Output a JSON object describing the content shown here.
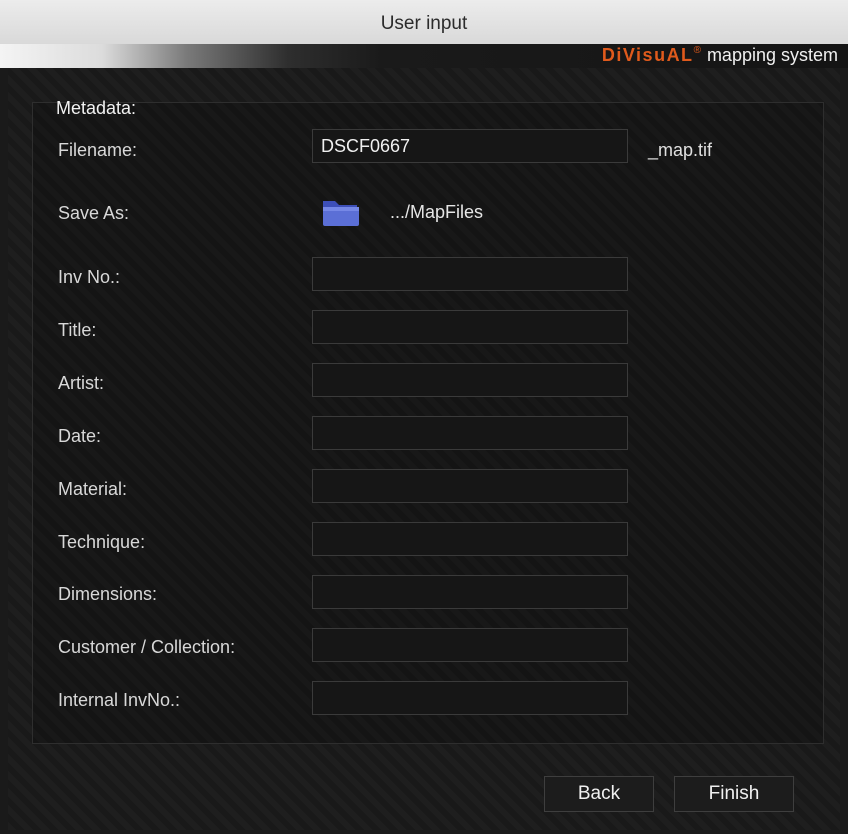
{
  "window": {
    "title": "User input"
  },
  "banner": {
    "brand_name": "DiVisuAL",
    "brand_reg": "®",
    "brand_sub": "mapping system"
  },
  "form": {
    "heading": "Metadata:",
    "filename": {
      "label": "Filename:",
      "value": "DSCF0667",
      "suffix": "_map.tif"
    },
    "save_as": {
      "label": "Save As:",
      "path": ".../MapFiles"
    },
    "fields": [
      {
        "label": "Inv No.:",
        "value": ""
      },
      {
        "label": "Title:",
        "value": ""
      },
      {
        "label": "Artist:",
        "value": ""
      },
      {
        "label": "Date:",
        "value": ""
      },
      {
        "label": "Material:",
        "value": ""
      },
      {
        "label": "Technique:",
        "value": ""
      },
      {
        "label": "Dimensions:",
        "value": ""
      },
      {
        "label": "Customer / Collection:",
        "value": ""
      },
      {
        "label": "Internal InvNo.:",
        "value": ""
      }
    ]
  },
  "buttons": {
    "back": "Back",
    "finish": "Finish"
  },
  "icons": {
    "save_folder": "folder-icon"
  },
  "colors": {
    "brand": "#e05a1c",
    "folder": "#5b6fd6"
  }
}
